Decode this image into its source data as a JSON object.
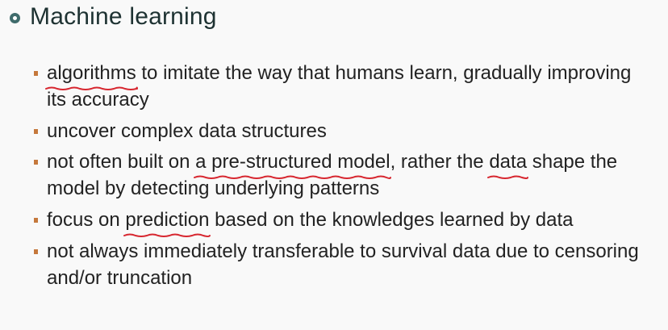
{
  "slide": {
    "title": "Machine learning",
    "annotation_color": "#d7262f",
    "bullet_color": "#c5783c",
    "bullets": [
      {
        "segments": [
          {
            "text": "algorithms",
            "underlined": true
          },
          {
            "text": " to imitate the way that humans learn, gradually improving its accuracy",
            "underlined": false
          }
        ]
      },
      {
        "segments": [
          {
            "text": "uncover complex data structures",
            "underlined": false
          }
        ]
      },
      {
        "segments": [
          {
            "text": "not often built on ",
            "underlined": false
          },
          {
            "text": "a pre-structured model",
            "underlined": true
          },
          {
            "text": ", rather the ",
            "underlined": false
          },
          {
            "text": "data",
            "underlined": true
          },
          {
            "text": " shape the model by detecting underlying patterns",
            "underlined": false
          }
        ]
      },
      {
        "segments": [
          {
            "text": "focus on ",
            "underlined": false
          },
          {
            "text": "prediction",
            "underlined": true
          },
          {
            "text": " based on the knowledges learned by data",
            "underlined": false
          }
        ]
      },
      {
        "segments": [
          {
            "text": "not always immediately transferable to survival data due to censoring and/or truncation",
            "underlined": false
          }
        ]
      }
    ]
  }
}
